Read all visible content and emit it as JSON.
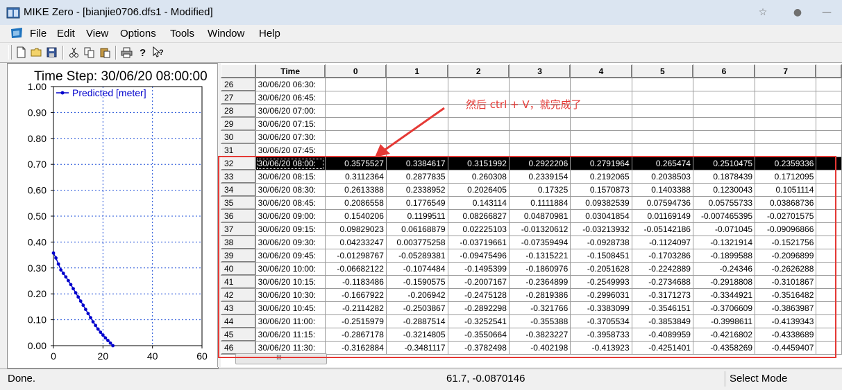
{
  "window": {
    "title": "MIKE Zero - [bianjie0706.dfs1 - Modified]"
  },
  "menu": [
    "File",
    "Edit",
    "View",
    "Options",
    "Tools",
    "Window",
    "Help"
  ],
  "toolbar": [
    "new-file-icon",
    "open-folder-icon",
    "save-icon",
    "cut-icon",
    "copy-icon",
    "paste-icon",
    "print-icon",
    "help-icon",
    "context-help-icon"
  ],
  "chart": {
    "title": "Time Step: 30/06/20 08:00:00",
    "legend": "Predicted [meter]",
    "series_color": "#0000cc",
    "yticks": [
      "1.00",
      "0.90",
      "0.80",
      "0.70",
      "0.60",
      "0.50",
      "0.40",
      "0.30",
      "0.20",
      "0.10",
      "0.00"
    ],
    "xticks": [
      "0",
      "20",
      "40",
      "60"
    ]
  },
  "chart_data": {
    "type": "line",
    "title": "Time Step: 30/06/20 08:00:00",
    "xlabel": "",
    "ylabel": "",
    "xlim": [
      0,
      60
    ],
    "ylim": [
      0,
      1
    ],
    "grid": true,
    "legend_position": "top-left",
    "series": [
      {
        "name": "Predicted [meter]",
        "x": [
          0,
          1,
          2,
          3,
          4,
          5,
          6,
          7,
          8,
          9,
          10,
          11,
          12,
          13,
          14,
          15,
          16,
          17,
          18,
          19,
          20,
          21,
          22,
          23,
          24
        ],
        "y": [
          0.3575527,
          0.3384617,
          0.3151992,
          0.2922206,
          0.2791964,
          0.265474,
          0.2510475,
          0.2359336,
          0.22,
          0.204,
          0.188,
          0.172,
          0.156,
          0.14,
          0.124,
          0.108,
          0.092,
          0.078,
          0.064,
          0.052,
          0.041,
          0.03,
          0.02,
          0.01,
          0.0
        ]
      }
    ]
  },
  "grid": {
    "time_header": "Time",
    "columns": [
      "0",
      "1",
      "2",
      "3",
      "4",
      "5",
      "6",
      "7"
    ],
    "selected_row": "32",
    "rows": [
      {
        "id": "26",
        "time": "30/06/20 06:30:",
        "values": [
          "",
          "",
          "",
          "",
          "",
          "",
          "",
          ""
        ]
      },
      {
        "id": "27",
        "time": "30/06/20 06:45:",
        "values": [
          "",
          "",
          "",
          "",
          "",
          "",
          "",
          ""
        ]
      },
      {
        "id": "28",
        "time": "30/06/20 07:00:",
        "values": [
          "",
          "",
          "",
          "",
          "",
          "",
          "",
          ""
        ]
      },
      {
        "id": "29",
        "time": "30/06/20 07:15:",
        "values": [
          "",
          "",
          "",
          "",
          "",
          "",
          "",
          ""
        ]
      },
      {
        "id": "30",
        "time": "30/06/20 07:30:",
        "values": [
          "",
          "",
          "",
          "",
          "",
          "",
          "",
          ""
        ]
      },
      {
        "id": "31",
        "time": "30/06/20 07:45:",
        "values": [
          "",
          "",
          "",
          "",
          "",
          "",
          "",
          ""
        ]
      },
      {
        "id": "32",
        "time": "30/06/20 08:00:",
        "values": [
          "0.3575527",
          "0.3384617",
          "0.3151992",
          "0.2922206",
          "0.2791964",
          "0.265474",
          "0.2510475",
          "0.2359336"
        ]
      },
      {
        "id": "33",
        "time": "30/06/20 08:15:",
        "values": [
          "0.3112364",
          "0.2877835",
          "0.260308",
          "0.2339154",
          "0.2192065",
          "0.2038503",
          "0.1878439",
          "0.1712095"
        ]
      },
      {
        "id": "34",
        "time": "30/06/20 08:30:",
        "values": [
          "0.2613388",
          "0.2338952",
          "0.2026405",
          "0.17325",
          "0.1570873",
          "0.1403388",
          "0.1230043",
          "0.1051114"
        ]
      },
      {
        "id": "35",
        "time": "30/06/20 08:45:",
        "values": [
          "0.2086558",
          "0.1776549",
          "0.143114",
          "0.1111884",
          "0.09382539",
          "0.07594736",
          "0.05755733",
          "0.03868736"
        ]
      },
      {
        "id": "36",
        "time": "30/06/20 09:00:",
        "values": [
          "0.1540206",
          "0.1199511",
          "0.08266827",
          "0.04870981",
          "0.03041854",
          "0.01169149",
          "-0.007465395",
          "-0.02701575"
        ]
      },
      {
        "id": "37",
        "time": "30/06/20 09:15:",
        "values": [
          "0.09829023",
          "0.06168879",
          "0.02225103",
          "-0.01320612",
          "-0.03213932",
          "-0.05142186",
          "-0.071045",
          "-0.09096866"
        ]
      },
      {
        "id": "38",
        "time": "30/06/20 09:30:",
        "values": [
          "0.04233247",
          "0.003775258",
          "-0.03719661",
          "-0.07359494",
          "-0.0928738",
          "-0.1124097",
          "-0.1321914",
          "-0.1521756"
        ]
      },
      {
        "id": "39",
        "time": "30/06/20 09:45:",
        "values": [
          "-0.01298767",
          "-0.05289381",
          "-0.09475496",
          "-0.1315221",
          "-0.1508451",
          "-0.1703286",
          "-0.1899588",
          "-0.2096899"
        ]
      },
      {
        "id": "40",
        "time": "30/06/20 10:00:",
        "values": [
          "-0.06682122",
          "-0.1074484",
          "-0.1495399",
          "-0.1860976",
          "-0.2051628",
          "-0.2242889",
          "-0.24346",
          "-0.2626288"
        ]
      },
      {
        "id": "41",
        "time": "30/06/20 10:15:",
        "values": [
          "-0.1183486",
          "-0.1590575",
          "-0.2007167",
          "-0.2364899",
          "-0.2549993",
          "-0.2734688",
          "-0.2918808",
          "-0.3101867"
        ]
      },
      {
        "id": "42",
        "time": "30/06/20 10:30:",
        "values": [
          "-0.1667922",
          "-0.206942",
          "-0.2475128",
          "-0.2819386",
          "-0.2996031",
          "-0.3171273",
          "-0.3344921",
          "-0.3516482"
        ]
      },
      {
        "id": "43",
        "time": "30/06/20 10:45:",
        "values": [
          "-0.2114282",
          "-0.2503867",
          "-0.2892298",
          "-0.321766",
          "-0.3383099",
          "-0.3546151",
          "-0.3706609",
          "-0.3863987"
        ]
      },
      {
        "id": "44",
        "time": "30/06/20 11:00:",
        "values": [
          "-0.2515979",
          "-0.2887514",
          "-0.3252541",
          "-0.355388",
          "-0.3705534",
          "-0.3853849",
          "-0.3998611",
          "-0.4139343"
        ]
      },
      {
        "id": "45",
        "time": "30/06/20 11:15:",
        "values": [
          "-0.2867178",
          "-0.3214805",
          "-0.3550664",
          "-0.3823227",
          "-0.3958733",
          "-0.4089959",
          "-0.4216802",
          "-0.4338689"
        ]
      },
      {
        "id": "46",
        "time": "30/06/20 11:30:",
        "values": [
          "-0.3162884",
          "-0.3481117",
          "-0.3782498",
          "-0.402198",
          "-0.413923",
          "-0.4251401",
          "-0.4358269",
          "-0.4459407"
        ]
      }
    ]
  },
  "annotation": {
    "text": "然后 ctrl + V，就完成了",
    "color": "#e53935"
  },
  "status": {
    "left": "Done.",
    "coords": "61.7, -0.0870146",
    "mode": "Select Mode"
  }
}
